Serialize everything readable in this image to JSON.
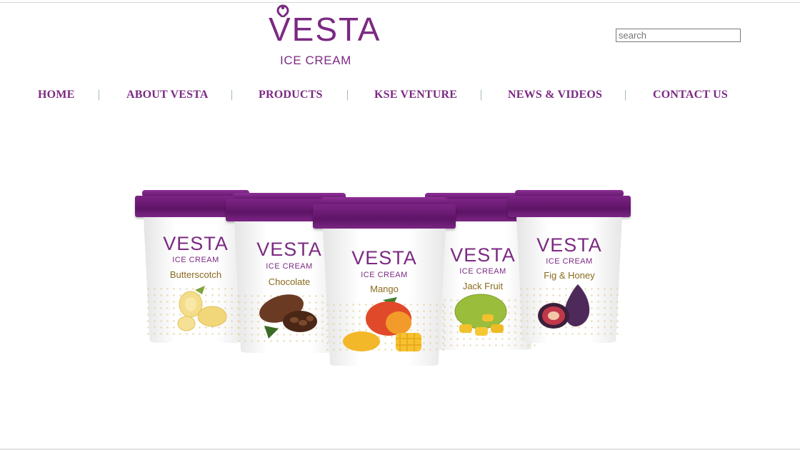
{
  "logo": {
    "wordmark": "VESTA",
    "subtitle": "ICE CREAM"
  },
  "search": {
    "placeholder": "search",
    "value": ""
  },
  "nav": {
    "items": [
      {
        "label": "HOME"
      },
      {
        "label": "ABOUT VESTA"
      },
      {
        "label": "PRODUCTS"
      },
      {
        "label": "KSE VENTURE"
      },
      {
        "label": "NEWS & VIDEOS"
      },
      {
        "label": "CONTACT US"
      }
    ],
    "separator": "|"
  },
  "hero": {
    "tubs": [
      {
        "brand": "VESTA",
        "sub": "ICE CREAM",
        "flavor": "Butterscotch",
        "fruit_icon": "butterscotch-curls-icon"
      },
      {
        "brand": "VESTA",
        "sub": "ICE CREAM",
        "flavor": "Chocolate",
        "fruit_icon": "cocoa-pod-icon"
      },
      {
        "brand": "VESTA",
        "sub": "ICE CREAM",
        "flavor": "Mango",
        "fruit_icon": "mango-icon"
      },
      {
        "brand": "VESTA",
        "sub": "ICE CREAM",
        "flavor": "Jack Fruit",
        "fruit_icon": "jackfruit-icon"
      },
      {
        "brand": "VESTA",
        "sub": "ICE CREAM",
        "flavor": "Fig & Honey",
        "fruit_icon": "fig-icon"
      }
    ]
  },
  "colors": {
    "brand_purple": "#7b2a82",
    "separator": "#8aa9b8"
  }
}
